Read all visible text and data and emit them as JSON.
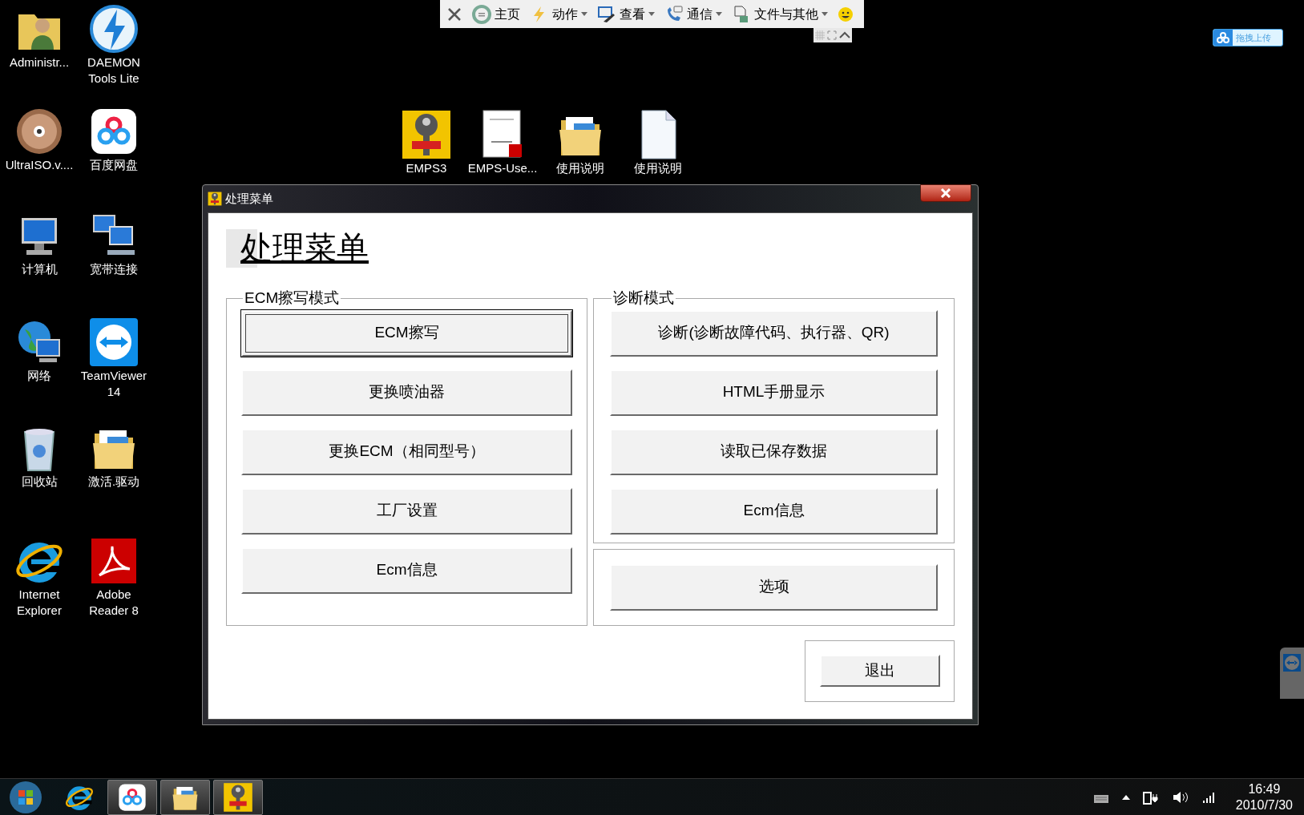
{
  "toolbar": {
    "items": [
      {
        "kind": "home",
        "label": "主页",
        "dropdown": false
      },
      {
        "kind": "action",
        "label": "动作",
        "dropdown": true
      },
      {
        "kind": "view",
        "label": "查看",
        "dropdown": true
      },
      {
        "kind": "chat",
        "label": "通信",
        "dropdown": true
      },
      {
        "kind": "files",
        "label": "文件与其他",
        "dropdown": true
      }
    ]
  },
  "upload_badge": {
    "label": "拖拽上传"
  },
  "desktop_icons": [
    {
      "kind": "user",
      "label": "Administr..."
    },
    {
      "kind": "disc",
      "label": "DAEMON Tools Lite"
    },
    {
      "kind": "disc2",
      "label": "UltraISO.v...."
    },
    {
      "kind": "cloud",
      "label": "百度网盘"
    },
    {
      "kind": "computer",
      "label": "计算机"
    },
    {
      "kind": "network",
      "label": "宽带连接"
    },
    {
      "kind": "globe",
      "label": "网络"
    },
    {
      "kind": "remote",
      "label": "TeamViewer 14"
    },
    {
      "kind": "trash",
      "label": "回收站"
    },
    {
      "kind": "folder",
      "label": "激活.驱动"
    },
    {
      "kind": "browser",
      "label": "Internet Explorer"
    },
    {
      "kind": "pdf",
      "label": "Adobe Reader 8"
    },
    {
      "kind": "key",
      "label": "EMPS3"
    },
    {
      "kind": "document",
      "label": "EMPS-Use..."
    },
    {
      "kind": "folder",
      "label": "使用说明"
    },
    {
      "kind": "file",
      "label": "使用说明"
    }
  ],
  "window": {
    "title": "处理菜单",
    "heading": "处理菜单",
    "left_group": {
      "label": "ECM擦写模式",
      "buttons": [
        {
          "label": "ECM擦写",
          "focused": true
        },
        {
          "label": "更换喷油器",
          "focused": false
        },
        {
          "label": "更换ECM（相同型号）",
          "focused": false
        },
        {
          "label": "工厂设置",
          "focused": false
        },
        {
          "label": "Ecm信息",
          "focused": false
        }
      ]
    },
    "right_group": {
      "label": "诊断模式",
      "buttons": [
        {
          "label": "诊断(诊断故障代码、执行器、QR)",
          "focused": false
        },
        {
          "label": "HTML手册显示",
          "focused": false
        },
        {
          "label": "读取已保存数据",
          "focused": false
        },
        {
          "label": "Ecm信息",
          "focused": false
        }
      ]
    },
    "options_button": "选项",
    "exit_button": "退出"
  },
  "taskbar": {
    "items": [
      {
        "kind": "browser",
        "running": false
      },
      {
        "kind": "cloud",
        "running": true
      },
      {
        "kind": "folder",
        "running": true
      },
      {
        "kind": "key",
        "running": true
      }
    ],
    "time": "16:49",
    "date": "2010/7/30"
  }
}
